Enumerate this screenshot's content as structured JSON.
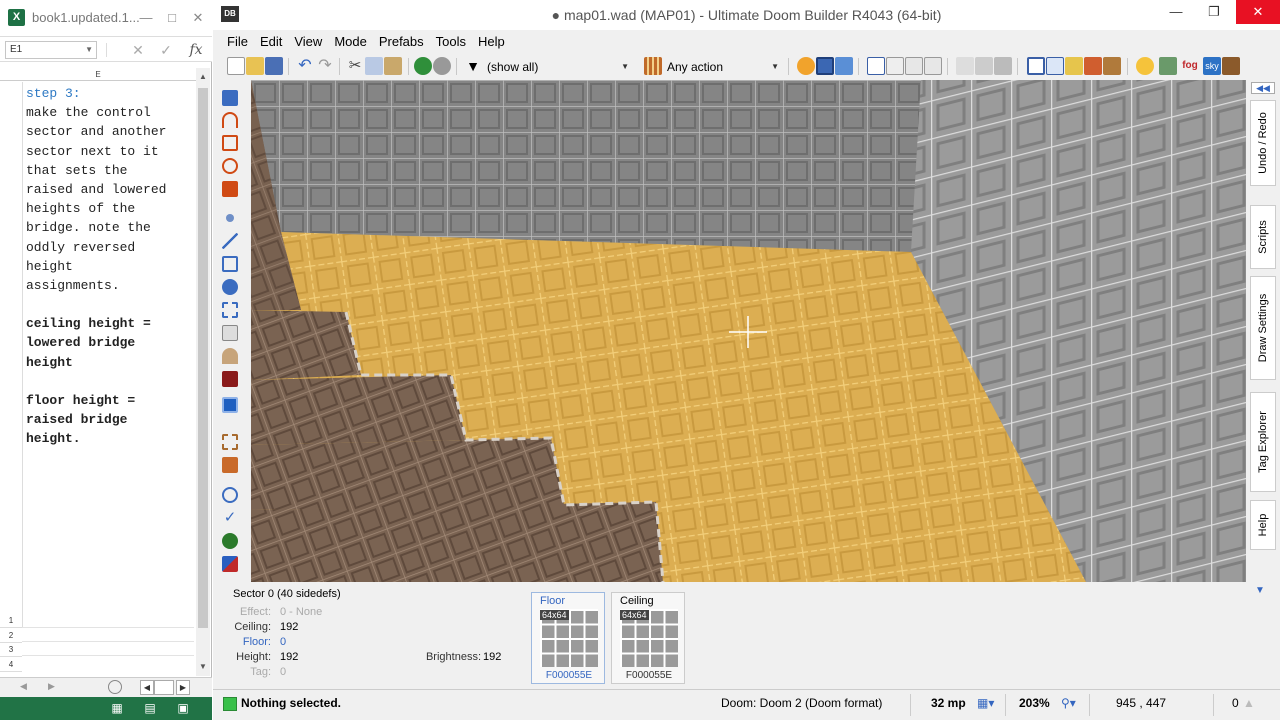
{
  "excel": {
    "title": "book1.updated.1...",
    "namebox": "E1",
    "column_header": "E",
    "note_lines": [
      {
        "text": "step 3:",
        "style": "step"
      },
      {
        "text": "make the control",
        "style": "plain"
      },
      {
        "text": "sector and another",
        "style": "plain"
      },
      {
        "text": "sector next to it",
        "style": "plain"
      },
      {
        "text": "that sets the",
        "style": "plain"
      },
      {
        "text": "raised and lowered",
        "style": "plain"
      },
      {
        "text": "heights of the",
        "style": "plain"
      },
      {
        "text": "bridge. note the",
        "style": "plain"
      },
      {
        "text": "oddly reversed",
        "style": "plain"
      },
      {
        "text": "height",
        "style": "plain"
      },
      {
        "text": "assignments.",
        "style": "plain"
      },
      {
        "text": "",
        "style": "plain"
      },
      {
        "text": "ceiling height =",
        "style": "bold"
      },
      {
        "text": "lowered bridge",
        "style": "bold"
      },
      {
        "text": "height",
        "style": "bold"
      },
      {
        "text": "",
        "style": "plain"
      },
      {
        "text": "floor height =",
        "style": "bold"
      },
      {
        "text": "raised bridge",
        "style": "bold"
      },
      {
        "text": "height.",
        "style": "bold"
      }
    ],
    "row_numbers": [
      "1",
      "2",
      "3",
      "4"
    ]
  },
  "udb": {
    "title": "● map01.wad (MAP01) - Ultimate Doom Builder R4043 (64-bit)",
    "logo": "DB",
    "menu": [
      "File",
      "Edit",
      "View",
      "Mode",
      "Prefabs",
      "Tools",
      "Help"
    ],
    "filter_label": "(show all)",
    "action_label": "Any action",
    "right_tabs": [
      "Undo / Redo",
      "Scripts",
      "Draw Settings",
      "Tag Explorer",
      "Help"
    ],
    "sector_panel": {
      "title": "Sector 0 (40 sidedefs)",
      "effect_label": "Effect:",
      "effect_value": "0 - None",
      "ceiling_label": "Ceiling:",
      "ceiling_value": "192",
      "floor_label": "Floor:",
      "floor_value": "0",
      "height_label": "Height:",
      "height_value": "192",
      "tag_label": "Tag:",
      "tag_value": "0",
      "brightness_label": "Brightness:",
      "brightness_value": "192"
    },
    "floor_tex": {
      "label": "Floor",
      "size": "64x64",
      "name": "F000055E"
    },
    "ceiling_tex": {
      "label": "Ceiling",
      "size": "64x64",
      "name": "F000055E"
    },
    "status": {
      "message": "Nothing selected.",
      "game": "Doom: Doom 2 (Doom format)",
      "grid": "32 mp",
      "zoom": "203%",
      "coords": "945 , 447",
      "extra": "0"
    }
  },
  "colors": {
    "excel_green": "#217346",
    "udb_close": "#e81123",
    "floor_yellow": "#e2b455",
    "wall_gray": "#8a8a8a",
    "stair_brown": "#7b6452",
    "status_icon_green": "#3ac04a"
  }
}
